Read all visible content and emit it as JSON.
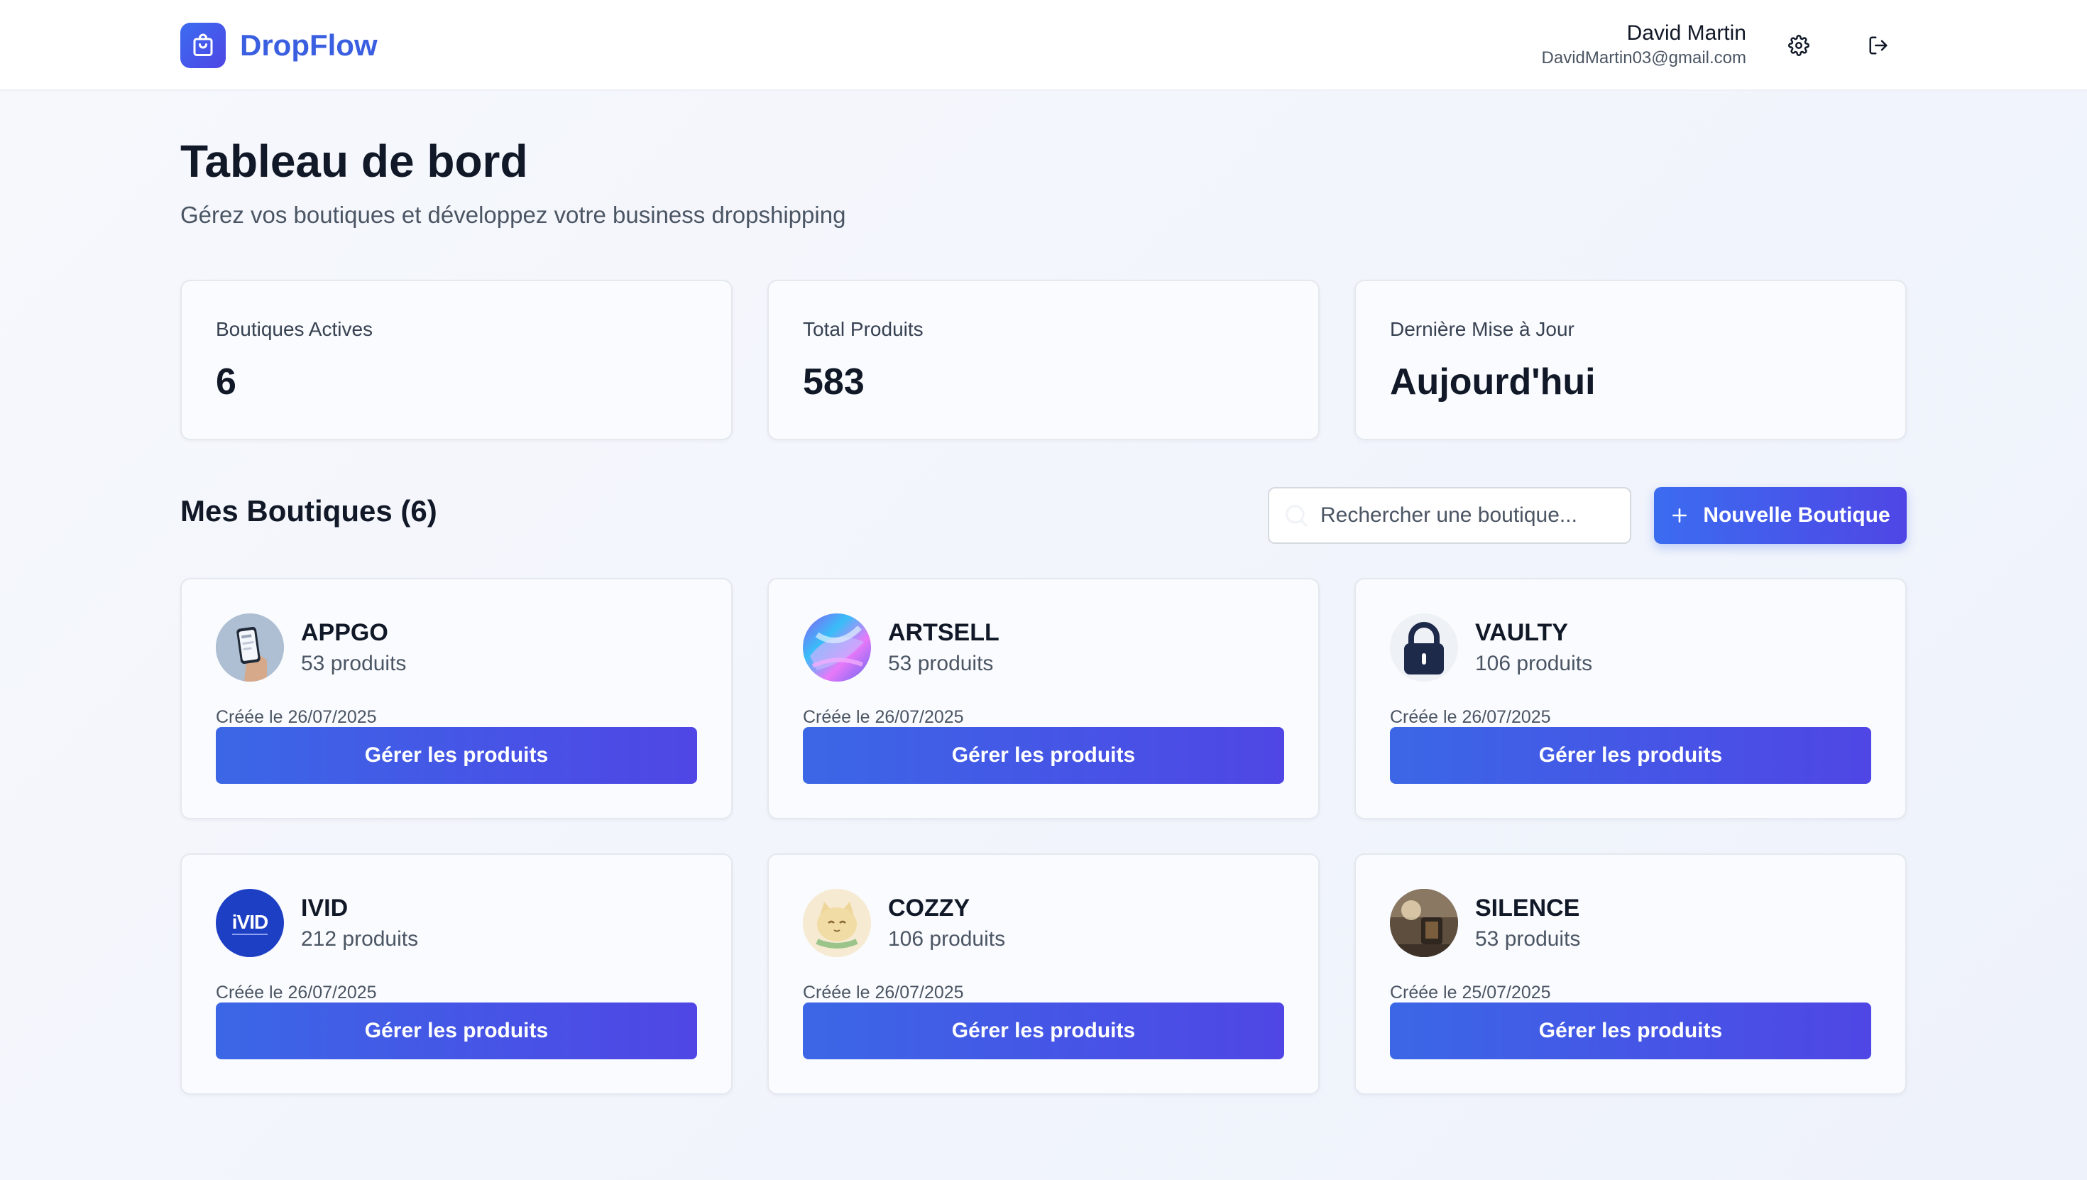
{
  "app": {
    "name": "DropFlow"
  },
  "user": {
    "name": "David Martin",
    "email": "DavidMartin03@gmail.com"
  },
  "header": {
    "settings_icon": "gear-icon",
    "logout_icon": "logout-icon"
  },
  "page": {
    "title": "Tableau de bord",
    "subtitle": "Gérez vos boutiques et développez votre business dropshipping"
  },
  "stats": [
    {
      "label": "Boutiques Actives",
      "value": "6"
    },
    {
      "label": "Total Produits",
      "value": "583"
    },
    {
      "label": "Dernière Mise à Jour",
      "value": "Aujourd'hui"
    }
  ],
  "stores_section": {
    "title": "Mes Boutiques (6)",
    "search_placeholder": "Rechercher une boutique...",
    "new_button": "Nouvelle Boutique"
  },
  "stores": [
    {
      "name": "APPGO",
      "products": "53 produits",
      "created": "Créée le 26/07/2025",
      "action": "Gérer les produits",
      "avatar": "phone-in-hand-image"
    },
    {
      "name": "ARTSELL",
      "products": "53 produits",
      "created": "Créée le 26/07/2025",
      "action": "Gérer les produits",
      "avatar": "holographic-shape-image"
    },
    {
      "name": "VAULTY",
      "products": "106 produits",
      "created": "Créée le 26/07/2025",
      "action": "Gérer les produits",
      "avatar": "padlock-image"
    },
    {
      "name": "IVID",
      "products": "212 produits",
      "created": "Créée le 26/07/2025",
      "action": "Gérer les produits",
      "avatar": "ivid-logo",
      "avatar_text": "iVID"
    },
    {
      "name": "COZZY",
      "products": "106 produits",
      "created": "Créée le 26/07/2025",
      "action": "Gérer les produits",
      "avatar": "cat-plush-image"
    },
    {
      "name": "SILENCE",
      "products": "53 produits",
      "created": "Créée le 25/07/2025",
      "action": "Gérer les produits",
      "avatar": "interior-lamp-image"
    }
  ],
  "colors": {
    "accent": "#3b6cf0",
    "accent_end": "#4f46e5",
    "text": "#111827",
    "muted": "#4b5563"
  }
}
